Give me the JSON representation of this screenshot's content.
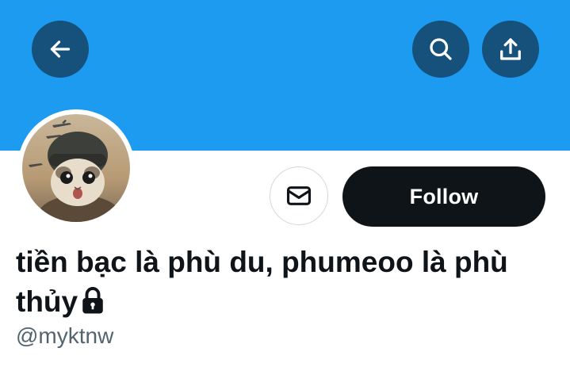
{
  "header": {
    "banner_color": "#1d9bf0",
    "back_icon": "arrow-left-icon",
    "search_icon": "search-icon",
    "share_icon": "share-icon"
  },
  "profile": {
    "avatar_description_icon": "avatar-cat-pilot-image",
    "display_name": "tiền bạc là phù du, phumeoo là phù thủy",
    "protected_icon": "lock-icon",
    "handle": "@myktnw"
  },
  "actions": {
    "message_icon": "envelope-icon",
    "follow_label": "Follow",
    "follow_bg": "#0f1419"
  }
}
